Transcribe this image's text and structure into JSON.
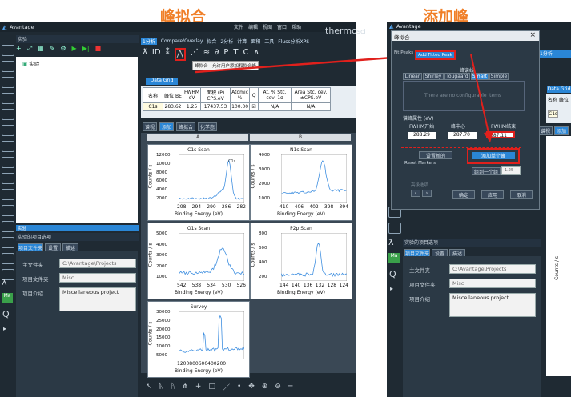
{
  "titles": {
    "left": "峰拟合",
    "right": "添加峰"
  },
  "left": {
    "app_name": "Avantage",
    "menu": [
      "文件",
      "编辑",
      "视图",
      "窗口",
      "帮助"
    ],
    "brand": "thermo",
    "brand_suffix": "sci",
    "experiment_label": "实验",
    "tree_item": "实验",
    "toolbar2_items": [
      "1分析",
      "Compare/Overlay",
      "拟合",
      "2分析",
      "计算",
      "面积",
      "工具",
      "Fluss分析XPS"
    ],
    "tooltip": "峰拟合 - 允许用户添加和拟合峰",
    "data_grid_tab": "Data Grid",
    "grid_headers": [
      "名称",
      "峰位 BE",
      "FWHM eV",
      "面积 (P) CPS.eV",
      "Atomic %",
      "Q",
      "At. % Stc. cev. 1σ",
      "Area Stc. cev. ±CPS.eV"
    ],
    "grid_row": [
      "C1s",
      "283.62",
      "1.25",
      "17437.53",
      "100.00",
      "☑",
      "N/A",
      "N/A"
    ],
    "subtabs": [
      "谱视",
      "添加",
      "峰拟合",
      "化学态"
    ],
    "col_labels": [
      "A",
      "B"
    ],
    "status_label": "实验",
    "props_title": "实验的项目选项",
    "props_tabs": [
      "项目文件夹",
      "设置",
      "描述"
    ],
    "props": [
      {
        "label": "主文件夹",
        "value": "C:\\Avantage\\Projects"
      },
      {
        "label": "项目文件夹",
        "value": "Misc"
      },
      {
        "label": "项目介绍",
        "value": "Miscellaneous project"
      }
    ],
    "plots": [
      {
        "title": "C1s Scan",
        "peak_label": "C1s",
        "xlabel": "Binding Energy (eV)",
        "ylabel": "Counts / s",
        "xticks": [
          "298",
          "294",
          "290",
          "286",
          "282"
        ],
        "yticks": [
          "12000",
          "10000",
          "8000",
          "6000",
          "4000",
          "2000"
        ]
      },
      {
        "title": "N1s Scan",
        "xlabel": "Binding Energy (eV)",
        "ylabel": "Counts / s",
        "xticks": [
          "410",
          "406",
          "402",
          "398",
          "394"
        ],
        "yticks": [
          "4000",
          "3000",
          "2000",
          "1000"
        ]
      },
      {
        "title": "O1s Scan",
        "xlabel": "Binding Energy (eV)",
        "ylabel": "Counts / s",
        "xticks": [
          "542",
          "538",
          "534",
          "530",
          "526"
        ],
        "yticks": [
          "5000",
          "4000",
          "3000",
          "2000",
          "1000"
        ]
      },
      {
        "title": "P2p Scan",
        "xlabel": "Binding Energy (eV)",
        "ylabel": "Counts / s",
        "xticks": [
          "144",
          "140",
          "136",
          "132",
          "128",
          "124"
        ],
        "yticks": [
          "800",
          "600",
          "400",
          "200"
        ]
      },
      {
        "title": "Survey",
        "xlabel": "Binding Energy (eV)",
        "ylabel": "Counts / s",
        "xticks": [
          "1200800600400200"
        ],
        "yticks": [
          "30000",
          "25000",
          "20000",
          "15000",
          "10000",
          "5000"
        ]
      }
    ]
  },
  "right": {
    "app_name": "Avantage",
    "dialog_title": "峰拟合",
    "close": "×",
    "tab_peaks": "Fit Peaks",
    "tab_add": "Add Fitted Peak",
    "group_bg": "峰谱线",
    "bg_tabs": [
      "Linear",
      "Shirley",
      "Tougaard",
      "Smart",
      "Simple"
    ],
    "no_items": "There are no configurable items",
    "group_props": "谱峰属性 (eV)",
    "col_fwhm_start": "FWHM开始",
    "col_center": "峰中心",
    "col_fwhm_end": "FWHM结束",
    "v1": "288.29",
    "v2": "287.70",
    "v3": "287.11",
    "reset_markers": "Reset Markers",
    "reset_btn": "设置新的",
    "add_btn": "添加单个峰",
    "extra_btn": "组到一个组",
    "small_val": "1.25",
    "group3": "高级选项",
    "btn_ok": "确定",
    "btn_apply": "应用",
    "btn_cancel": "取消",
    "side_tab": "1分析",
    "data_grid_tab": "Data Grid",
    "grid_headers": [
      "名称",
      "峰位"
    ],
    "grid_row": [
      "C1s",
      ""
    ],
    "subtabs": [
      "谱视",
      "添加"
    ],
    "props_title": "实验的项目选项",
    "props_tabs": [
      "项目文件夹",
      "设置",
      "描述"
    ],
    "props": [
      {
        "label": "主文件夹",
        "value": "C:\\Avantage\\Projects"
      },
      {
        "label": "项目文件夹",
        "value": "Misc"
      },
      {
        "label": "项目介绍",
        "value": "Miscellaneous project"
      }
    ],
    "ylabel": "Counts / s"
  },
  "colors": {
    "accent": "#f07f28",
    "highlight": "#e0201c",
    "tab_blue": "#2a86d6"
  }
}
